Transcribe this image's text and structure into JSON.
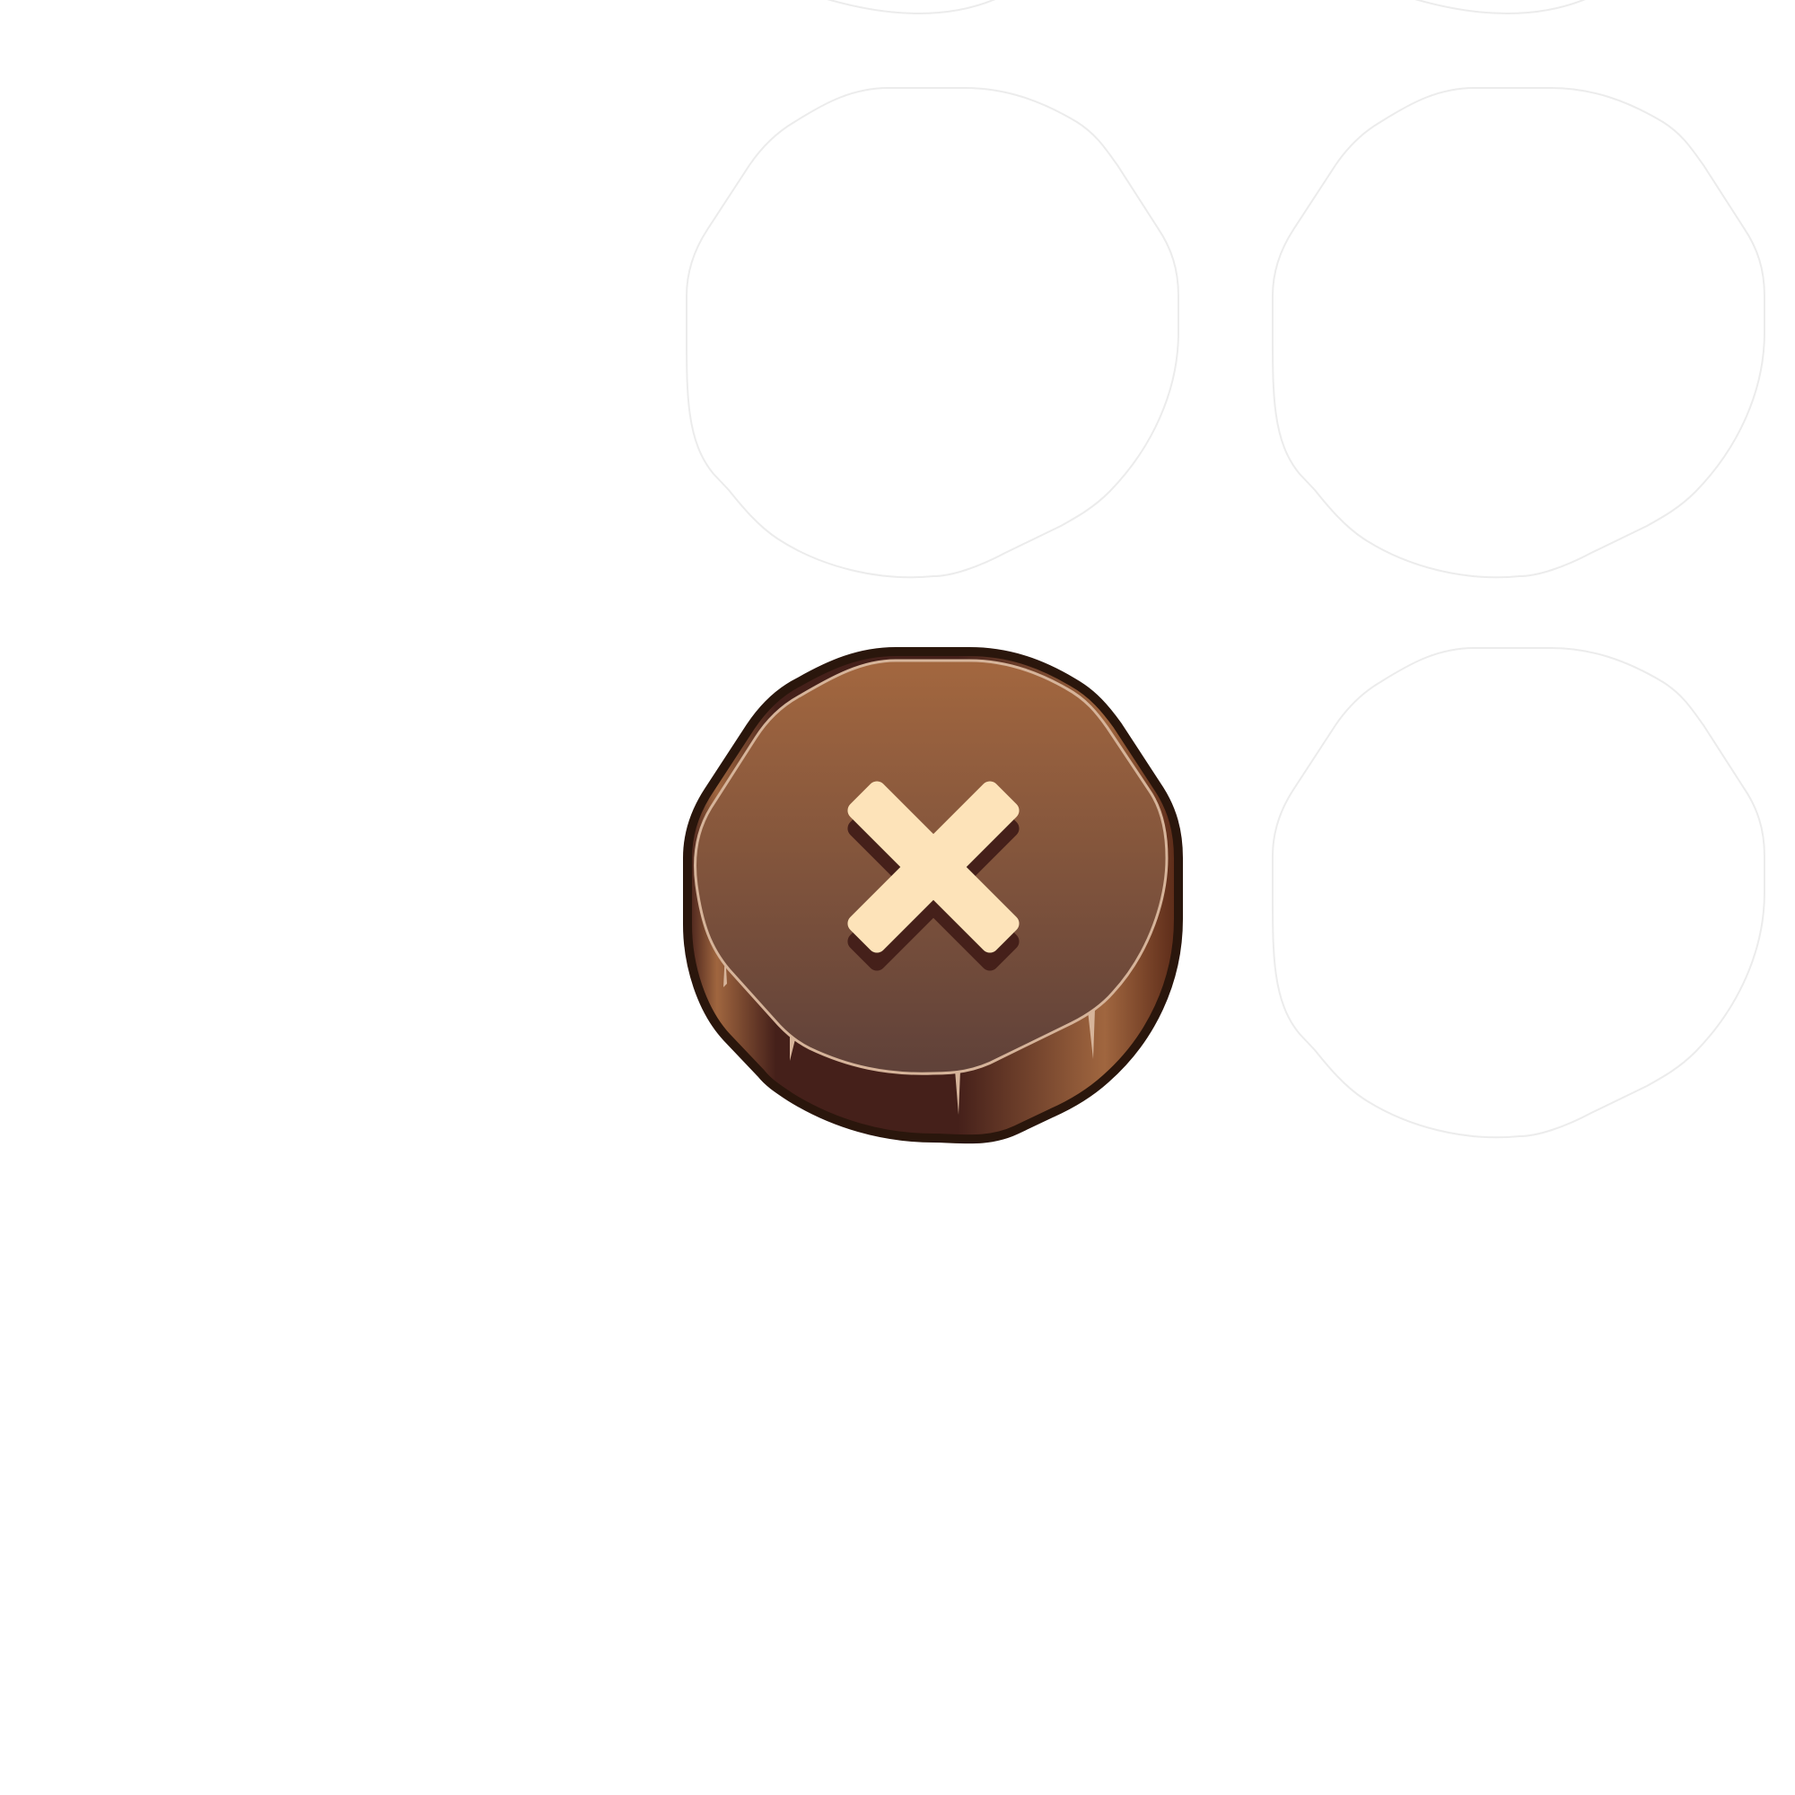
{
  "sprite_sheet": {
    "background_color": "#ffffff",
    "ghost_slot_outline_color": "#ececec",
    "buttons": [
      {
        "name": "close-button",
        "icon": "close-icon",
        "state": "visible",
        "colors": {
          "outline": "#2a160c",
          "face_top": "#a3673f",
          "face_bottom": "#5f4139",
          "side_dark": "#45201a",
          "side_highlight": "#a0663f",
          "rim_highlight": "#d6b49a",
          "icon_fill": "#fde3b9",
          "icon_shadow": "#45201a"
        }
      },
      {
        "name": "ghost-slot-top-left",
        "state": "empty"
      },
      {
        "name": "ghost-slot-top-right",
        "state": "empty"
      },
      {
        "name": "ghost-slot-mid-left",
        "state": "empty"
      },
      {
        "name": "ghost-slot-mid-right",
        "state": "empty"
      },
      {
        "name": "ghost-slot-bottom-right",
        "state": "empty"
      }
    ]
  }
}
